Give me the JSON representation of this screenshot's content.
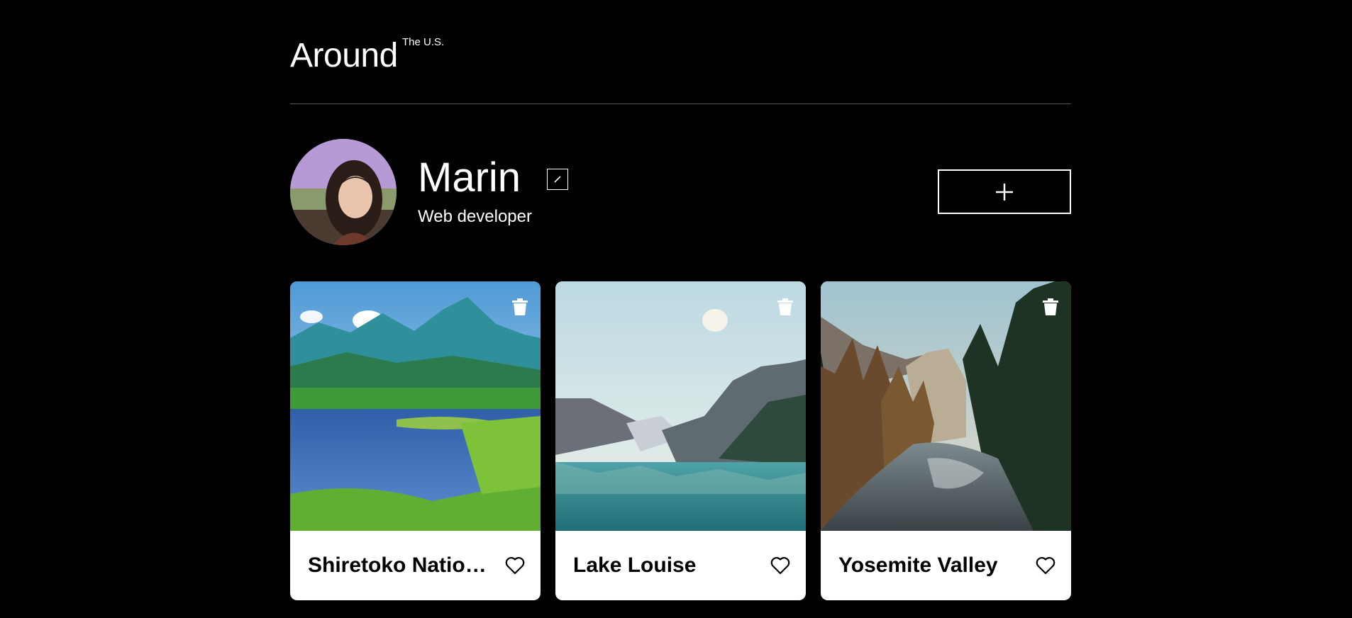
{
  "header": {
    "logo_main": "Around",
    "logo_sup": "The U.S."
  },
  "profile": {
    "name": "Marin",
    "job": "Web developer",
    "edit_icon": "pencil-icon",
    "add_icon": "plus-icon"
  },
  "cards": [
    {
      "title": "Shiretoko National Park",
      "liked": false
    },
    {
      "title": "Lake Louise",
      "liked": false
    },
    {
      "title": "Yosemite Valley",
      "liked": false
    }
  ],
  "colors": {
    "background": "#000000",
    "text": "#ffffff",
    "card_background": "#ffffff",
    "card_text": "#000000"
  }
}
